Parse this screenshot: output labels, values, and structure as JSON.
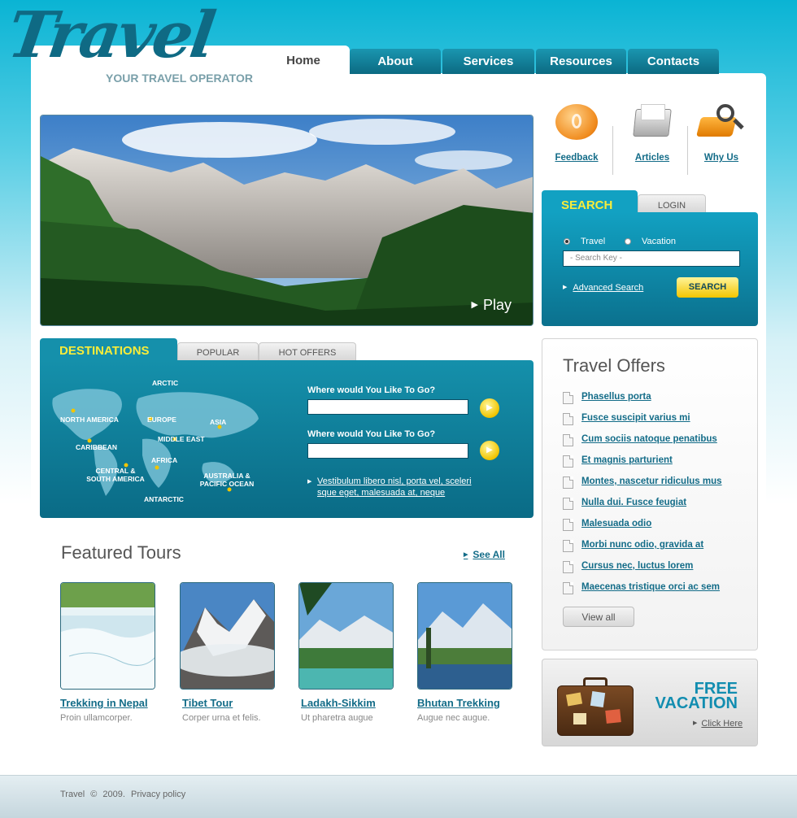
{
  "header": {
    "logo_text": "Travel",
    "tagline": "YOUR TRAVEL OPERATOR"
  },
  "nav": {
    "items": [
      {
        "label": "Home",
        "active": true
      },
      {
        "label": "About"
      },
      {
        "label": "Services"
      },
      {
        "label": "Resources"
      },
      {
        "label": "Contacts"
      }
    ]
  },
  "hero": {
    "play_label": "Play"
  },
  "destinations": {
    "tabs": [
      "DESTINATIONS",
      "POPULAR",
      "HOT OFFERS"
    ],
    "map_labels": [
      "ARCTIC",
      "NORTH AMERICA",
      "EUROPE",
      "ASIA",
      "MIDDLE EAST",
      "CARIBBEAN",
      "AFRICA",
      "CENTRAL & SOUTH AMERICA",
      "AUSTRALIA & PACIFIC OCEAN",
      "ANTARCTIC"
    ],
    "question1": "Where would You Like To Go?",
    "question2": "Where would You Like To Go?",
    "link_text": "Vestibulum libero nisl, porta vel, sceleri sque eget, malesuada at, neque"
  },
  "featured": {
    "title": "Featured Tours",
    "see_all": "See All",
    "tours": [
      {
        "title": "Trekking in Nepal",
        "desc": "Proin ullamcorper."
      },
      {
        "title": "Tibet Tour",
        "desc": "Corper urna et felis."
      },
      {
        "title": "Ladakh-Sikkim",
        "desc": "Ut pharetra augue"
      },
      {
        "title": "Bhutan Trekking",
        "desc": "Augue nec augue."
      }
    ]
  },
  "quicklinks": [
    {
      "label": "Feedback",
      "icon": "speech-bubble-icon"
    },
    {
      "label": "Articles",
      "icon": "folder-icon"
    },
    {
      "label": "Why Us",
      "icon": "magnifier-icon"
    }
  ],
  "search": {
    "tabs": [
      "SEARCH",
      "LOGIN"
    ],
    "radio1": "Travel",
    "radio2": "Vacation",
    "placeholder": "- Search Key -",
    "advanced": "Advanced Search",
    "button": "SEARCH"
  },
  "offers": {
    "title": "Travel Offers",
    "items": [
      "Phasellus porta",
      "Fusce suscipit varius mi",
      "Cum sociis natoque penatibus",
      "Et magnis parturient",
      "Montes, nascetur ridiculus mus",
      "Nulla dui. Fusce feugiat",
      "Malesuada odio",
      "Morbi nunc odio, gravida at",
      "Cursus nec, luctus lorem",
      "Maecenas tristique orci ac sem"
    ],
    "view_all": "View all"
  },
  "vacation": {
    "line1": "FREE",
    "line2": "VACATION",
    "link": "Click Here"
  },
  "footer": {
    "brand": "Travel",
    "copy": "©",
    "year": "2009.",
    "privacy": "Privacy policy"
  },
  "colors": {
    "accent": "#136c88",
    "teal": "#1590ab",
    "yellow": "#f8ec3a"
  }
}
